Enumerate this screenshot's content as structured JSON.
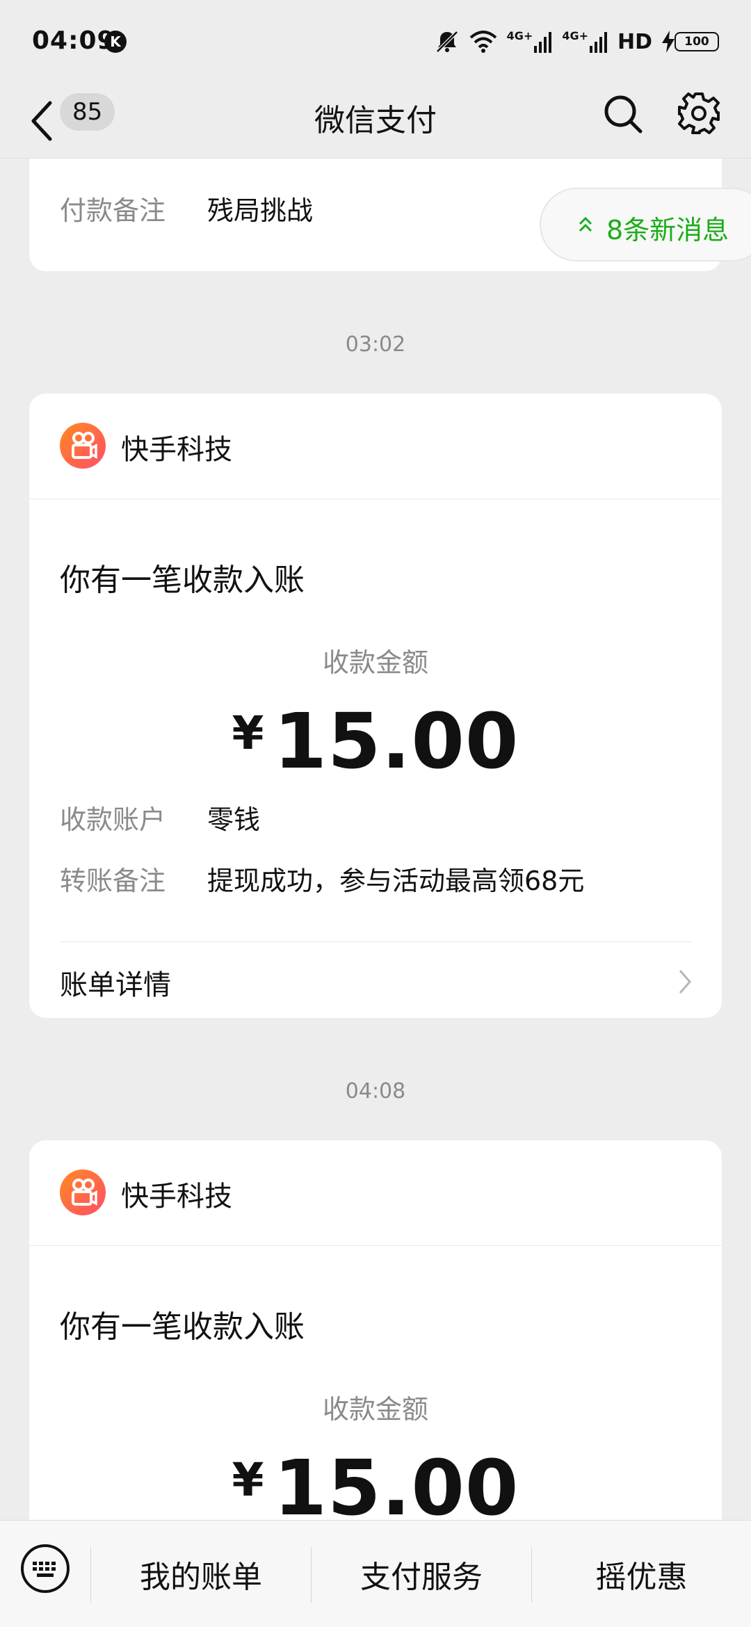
{
  "status_bar": {
    "time": "04:09",
    "k_badge": "K",
    "network1": "4G+",
    "network2": "4G+",
    "hd": "HD",
    "battery": "100"
  },
  "header": {
    "unread_count": "85",
    "title": "微信支付"
  },
  "top_card": {
    "label": "付款备注",
    "value": "残局挑战"
  },
  "new_messages": {
    "label": "8条新消息"
  },
  "messages": [
    {
      "timestamp": "03:02",
      "brand": "快手科技",
      "heading": "你有一笔收款入账",
      "amount_label": "收款金额",
      "currency": "¥",
      "amount": "15.00",
      "account_label": "收款账户",
      "account_value": "零钱",
      "note_label": "转账备注",
      "note_value": "提现成功，参与活动最高领68元",
      "detail_label": "账单详情"
    },
    {
      "timestamp": "04:08",
      "brand": "快手科技",
      "heading": "你有一笔收款入账",
      "amount_label": "收款金额",
      "currency": "¥",
      "amount": "15.00"
    }
  ],
  "bottom_menu": [
    "我的账单",
    "支付服务",
    "摇优惠"
  ],
  "colors": {
    "accent_green": "#1aad19",
    "background": "#ededed",
    "logo_orange": "#ff6a2b"
  }
}
